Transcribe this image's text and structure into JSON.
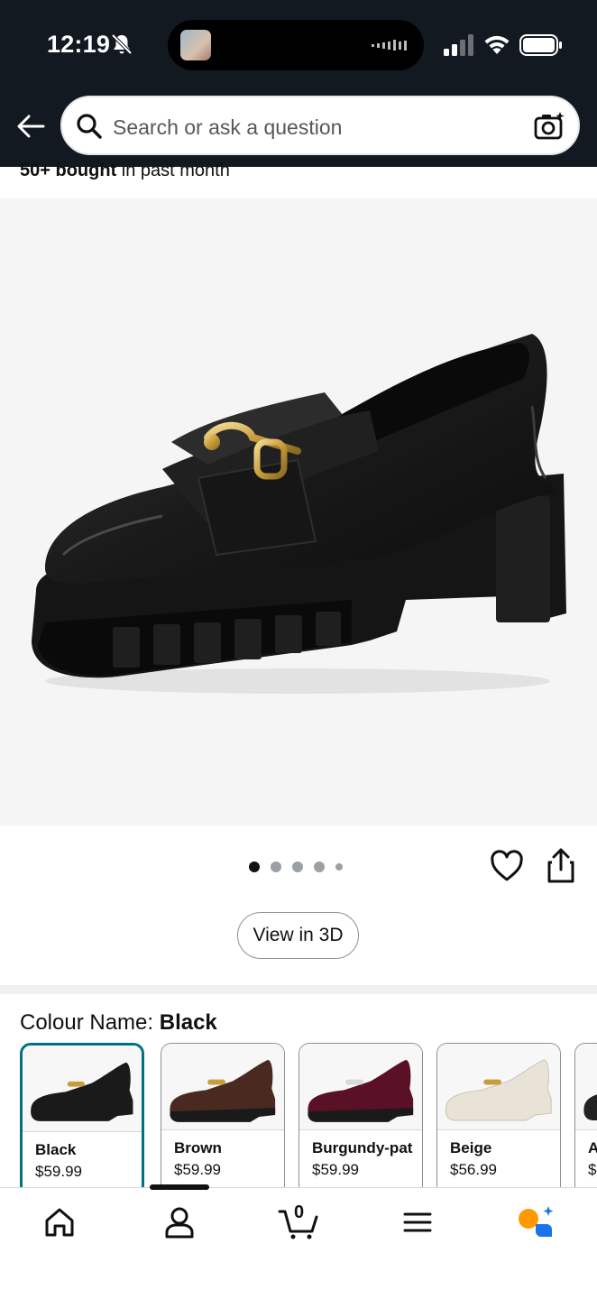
{
  "status_bar": {
    "time": "12:19"
  },
  "header": {
    "search_placeholder": "Search or ask a question"
  },
  "product": {
    "bought_bold": "50+ bought",
    "bought_rest": " in past month",
    "image_alt": "Black chunky platform loafer with gold horsebit buckle",
    "gallery": {
      "image_count": 5,
      "active_index": 0
    },
    "view_3d_label": "View in 3D"
  },
  "colour": {
    "label": "Colour Name: ",
    "selected": "Black",
    "options": [
      {
        "name": "Black",
        "price": "$59.99",
        "color": "#1a1a1a"
      },
      {
        "name": "Brown",
        "price": "$59.99",
        "color": "#4a2a20"
      },
      {
        "name": "Burgundy-pat",
        "price": "$59.99",
        "color": "#5a1025"
      },
      {
        "name": "Beige",
        "price": "$56.99",
        "color": "#e8e3d6"
      },
      {
        "name": "A",
        "price": "$",
        "color": "#222222"
      }
    ]
  },
  "bottom_nav": {
    "items": [
      "home-icon",
      "account-icon",
      "cart-icon",
      "menu-icon",
      "rufus-icon"
    ],
    "cart_count": "0"
  },
  "colors": {
    "header_bg": "#131921",
    "selected_border": "#007185",
    "rufus_orange": "#ff9900",
    "rufus_blue": "#1a73e8"
  }
}
